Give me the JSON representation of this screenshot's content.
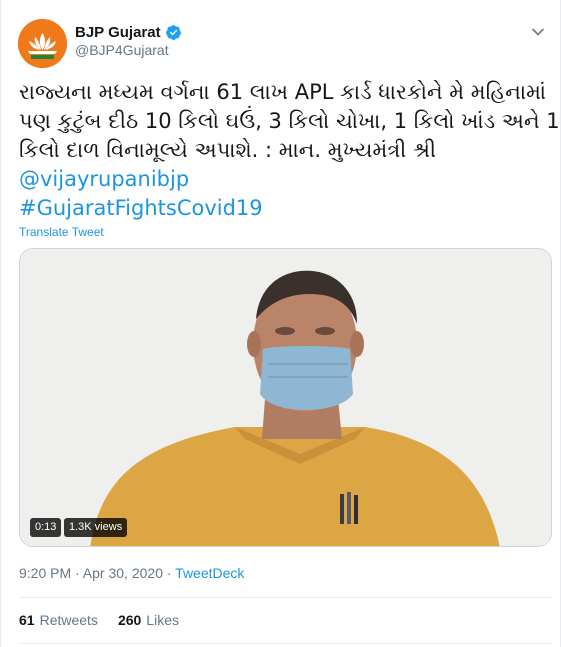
{
  "author": {
    "name": "BJP Gujarat",
    "handle": "@BJP4Gujarat",
    "avatar_icon": "bjp-lotus-logo",
    "verified_icon": "verified-badge-icon"
  },
  "tweet": {
    "lines": [
      "રાજ્યના મધ્યમ વર્ગના 61 લાખ APL કાર્ડ ધારકોને મે મહિનામાં",
      "પણ કુટુંબ દીઠ 10 કિલો ઘઉં, 3 કિલો ચોખા, 1 કિલો ખાંડ અને 1",
      "કિલો દાળ વિનામૂલ્યે અપાશે. : માન. મુખ્યમંત્રી શ્રી"
    ],
    "mention": "@vijayrupanibjp",
    "hashtag": "#GujaratFightsCovid19",
    "translate_label": "Translate Tweet"
  },
  "video": {
    "duration": "0:13",
    "views": "1.3K views"
  },
  "meta": {
    "time": "9:20 PM · Apr 30, 2020 · ",
    "source": "TweetDeck"
  },
  "stats": {
    "retweets_count": "61",
    "retweets_label": "Retweets",
    "likes_count": "260",
    "likes_label": "Likes"
  },
  "colors": {
    "link": "#1b95e0",
    "secondary_text": "#657786",
    "avatar_bg": "#f07a1a"
  }
}
